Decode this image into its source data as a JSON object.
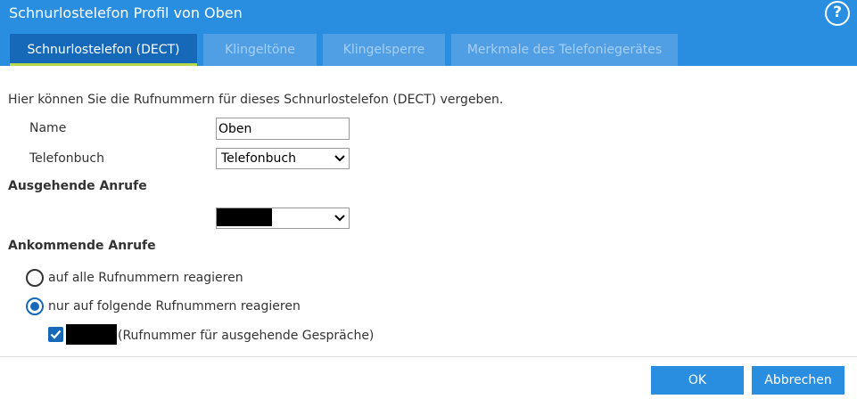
{
  "window": {
    "title": "Schnurlostelefon Profil von Oben",
    "help_glyph": "?"
  },
  "tabs": [
    {
      "label": "Schnurlostelefon (DECT)",
      "active": true
    },
    {
      "label": "Klingeltöne",
      "active": false
    },
    {
      "label": "Klingelsperre",
      "active": false
    },
    {
      "label": "Merkmale des Telefoniegerätes",
      "active": false
    }
  ],
  "form": {
    "intro": "Hier können Sie die Rufnummern für dieses Schnurlostelefon (DECT) vergeben.",
    "name_label": "Name",
    "name_value": "Oben",
    "phonebook_label": "Telefonbuch",
    "phonebook_value": "Telefonbuch",
    "outgoing_heading": "Ausgehende Anrufe",
    "incoming_heading": "Ankommende Anrufe",
    "radio_all": "auf alle Rufnummern reagieren",
    "radio_selected": "nur auf folgende Rufnummern reagieren",
    "number_note": "(Rufnummer für ausgehende Gespräche)"
  },
  "buttons": {
    "ok": "OK",
    "cancel": "Abbrechen"
  },
  "colors": {
    "header_blue": "#2a8ee0",
    "active_tab": "#1569b8",
    "tab_underline": "#b7d84b",
    "accent": "#1569b8"
  },
  "icons": {
    "help": "help-circle-icon",
    "dropdown": "chevron-down-icon",
    "checkbox": "checkmark-icon"
  }
}
